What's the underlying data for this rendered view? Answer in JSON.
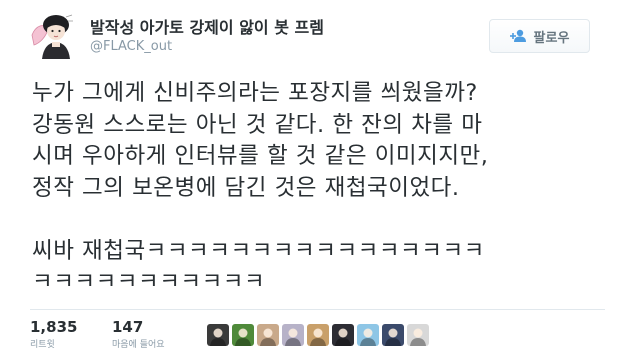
{
  "profile": {
    "display_name": "발작성 아가토 강제이 앓이 봇 프렘",
    "handle": "@FLACK_out",
    "avatar_icon": "cartoon-avatar"
  },
  "follow_button": {
    "label": "팔로우",
    "icon": "follow-person-plus-icon",
    "accent": "#66757f"
  },
  "tweet": {
    "lines": [
      "누가 그에게 신비주의라는 포장지를 씌웠을까?",
      "강동원 스스로는 아닌 것 같다. 한 잔의 차를 마",
      "시며 우아하게 인터뷰를 할 것 같은 이미지지만,",
      "정작 그의 보온병에 담긴 것은 재첩국이었다.",
      "",
      "씨바 재첩국ㅋㅋㅋㅋㅋㅋㅋㅋㅋㅋㅋㅋㅋㅋㅋㅋ",
      "ㅋㅋㅋㅋㅋㅋㅋㅋㅋㅋㅋ"
    ]
  },
  "stats": {
    "retweets": {
      "value": "1,835",
      "label": "리트윗"
    },
    "likes": {
      "value": "147",
      "label": "마음에 들어요"
    }
  },
  "likers": [
    {
      "icon": "liker-avatar-1",
      "color": "#3a3a3a"
    },
    {
      "icon": "liker-avatar-2",
      "color": "#4f8a3a"
    },
    {
      "icon": "liker-avatar-3",
      "color": "#c9a98a"
    },
    {
      "icon": "liker-avatar-4",
      "color": "#b7b2c8"
    },
    {
      "icon": "liker-avatar-5",
      "color": "#c9a06a"
    },
    {
      "icon": "liker-avatar-6",
      "color": "#2d2d34"
    },
    {
      "icon": "liker-avatar-7",
      "color": "#8ec6e6"
    },
    {
      "icon": "liker-avatar-8",
      "color": "#3b4a6b"
    },
    {
      "icon": "liker-avatar-9",
      "color": "#d8d8d8"
    }
  ]
}
